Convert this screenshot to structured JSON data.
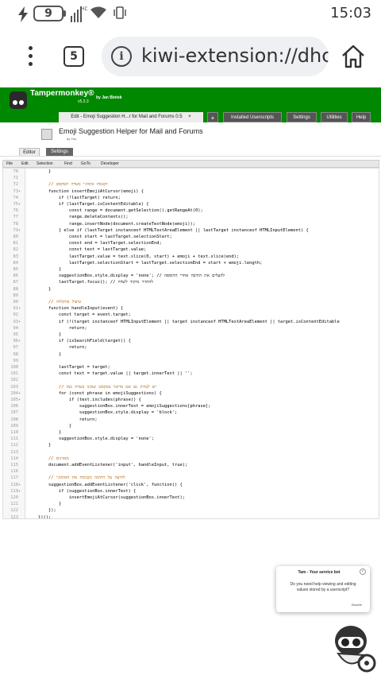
{
  "status_bar": {
    "battery": "9",
    "network": "HD",
    "time": "15:03",
    "icons": [
      "flash-icon",
      "battery-icon",
      "signal-icon",
      "wifi-icon",
      "vibrate-icon"
    ]
  },
  "browser": {
    "tab_count": "5",
    "url": "kiwi-extension://dhc"
  },
  "tampermonkey": {
    "title": "Tampermonkey®",
    "by": "by Jan Biniok",
    "version": "v5.3.3",
    "tabs": [
      {
        "label": "Edit - Emoji Suggestion H...r for Mail and Forums 0.5",
        "close": "×"
      },
      {
        "label": "+"
      },
      {
        "label": "Installed Userscripts"
      },
      {
        "label": "Settings"
      },
      {
        "label": "Utilities"
      },
      {
        "label": "Help"
      }
    ]
  },
  "script": {
    "name": "Emoji Suggestion Helper for Mail and Forums",
    "by": "by You",
    "subtabs": [
      "Editor",
      "Settings"
    ]
  },
  "editor": {
    "menu": [
      "File",
      "Edit",
      "Selection",
      "Find",
      "GoTo",
      "Developer"
    ],
    "lines": [
      {
        "n": "70",
        "f": "",
        "code": "        }"
      },
      {
        "n": "71",
        "f": "",
        "code": ""
      },
      {
        "n": "72",
        "f": "",
        "code": "        // הכנסת אימוג׳י בשדה הטקסט"
      },
      {
        "n": "73",
        "f": "▾",
        "code": "        function insertEmojiAtCursor(emoji) {"
      },
      {
        "n": "74",
        "f": "",
        "code": "            if (!lastTarget) return;"
      },
      {
        "n": "75",
        "f": "▾",
        "code": "            if (lastTarget.isContentEditable) {"
      },
      {
        "n": "76",
        "f": "",
        "code": "                const range = document.getSelection().getRangeAt(0);"
      },
      {
        "n": "77",
        "f": "",
        "code": "                range.deleteContents();"
      },
      {
        "n": "78",
        "f": "",
        "code": "                range.insertNode(document.createTextNode(emoji));"
      },
      {
        "n": "79",
        "f": "▾",
        "code": "            } else if (lastTarget instanceof HTMLTextAreaElement || lastTarget instanceof HTMLInputElement) {"
      },
      {
        "n": "80",
        "f": "",
        "code": "                const start = lastTarget.selectionStart;"
      },
      {
        "n": "81",
        "f": "",
        "code": "                const end = lastTarget.selectionEnd;"
      },
      {
        "n": "82",
        "f": "",
        "code": "                const text = lastTarget.value;"
      },
      {
        "n": "83",
        "f": "",
        "code": "                lastTarget.value = text.slice(0, start) + emoji + text.slice(end);"
      },
      {
        "n": "84",
        "f": "",
        "code": "                lastTarget.selectionStart = lastTarget.selectionEnd = start + emoji.length;"
      },
      {
        "n": "85",
        "f": "",
        "code": "            }"
      },
      {
        "n": "86",
        "f": "",
        "code": "            suggestionBox.style.display = 'none'; // להעלים את התיבה אחרי ההוספה"
      },
      {
        "n": "87",
        "f": "",
        "code": "            lastTarget.focus(); // להחזיר מיקוד לשדה"
      },
      {
        "n": "88",
        "f": "",
        "code": "        }"
      },
      {
        "n": "89",
        "f": "",
        "code": ""
      },
      {
        "n": "90",
        "f": "",
        "code": "        // טיפול בהקלדה"
      },
      {
        "n": "91",
        "f": "▾",
        "code": "        function handleInput(event) {"
      },
      {
        "n": "92",
        "f": "",
        "code": "            const target = event.target;"
      },
      {
        "n": "93",
        "f": "▾",
        "code": "            if (!(target instanceof HTMLInputElement || target instanceof HTMLTextAreaElement || target.isContentEditable"
      },
      {
        "n": "94",
        "f": "",
        "code": "                return;"
      },
      {
        "n": "95",
        "f": "",
        "code": "            }"
      },
      {
        "n": "96",
        "f": "▾",
        "code": "            if (isSearchField(target)) {"
      },
      {
        "n": "97",
        "f": "",
        "code": "                return;"
      },
      {
        "n": "98",
        "f": "",
        "code": "            }"
      },
      {
        "n": "99",
        "f": "",
        "code": ""
      },
      {
        "n": "100",
        "f": "",
        "code": "            lastTarget = target;"
      },
      {
        "n": "101",
        "f": "",
        "code": "            const text = target.value || target.innerText || '';"
      },
      {
        "n": "102",
        "f": "",
        "code": ""
      },
      {
        "n": "103",
        "f": "",
        "code": "            // יש לבדוק גם אם מדובר בטקסט שאינו בשדה כמו"
      },
      {
        "n": "104",
        "f": "▾",
        "code": "            for (const phrase in emojiSuggestions) {"
      },
      {
        "n": "105",
        "f": "▾",
        "code": "                if (text.includes(phrase)) {"
      },
      {
        "n": "106",
        "f": "",
        "code": "                    suggestionBox.innerText = emojiSuggestions[phrase];"
      },
      {
        "n": "107",
        "f": "",
        "code": "                    suggestionBox.style.display = 'block';"
      },
      {
        "n": "108",
        "f": "",
        "code": "                    return;"
      },
      {
        "n": "109",
        "f": "",
        "code": "                }"
      },
      {
        "n": "110",
        "f": "",
        "code": "            }"
      },
      {
        "n": "111",
        "f": "",
        "code": "            suggestionBox.style.display = 'none';"
      },
      {
        "n": "112",
        "f": "",
        "code": "        }"
      },
      {
        "n": "113",
        "f": "",
        "code": ""
      },
      {
        "n": "114",
        "f": "",
        "code": "        // מאזינים"
      },
      {
        "n": "115",
        "f": "",
        "code": "        document.addEventListener('input', handleInput, true);"
      },
      {
        "n": "116",
        "f": "",
        "code": ""
      },
      {
        "n": "117",
        "f": "",
        "code": "        // לחיצה על התיבה מכניסה את האימוג׳י"
      },
      {
        "n": "118",
        "f": "▾",
        "code": "        suggestionBox.addEventListener('click', function() {"
      },
      {
        "n": "119",
        "f": "▾",
        "code": "            if (suggestionBox.innerText) {"
      },
      {
        "n": "120",
        "f": "",
        "code": "                insertEmojiAtCursor(suggestionBox.innerText);"
      },
      {
        "n": "121",
        "f": "",
        "code": "            }"
      },
      {
        "n": "122",
        "f": "",
        "code": "        });"
      },
      {
        "n": "123",
        "f": "",
        "code": "    })();"
      }
    ]
  },
  "toast": {
    "title": "Tam - Your service bot",
    "close": "×",
    "body": "Do you need help viewing and editing values stored by a userscript?",
    "disable": "Disable"
  },
  "colors": {
    "tm_green": "#008800",
    "keyword": "#770088",
    "variable": "#0055aa",
    "comment": "#aa5500",
    "string": "#aa1111"
  }
}
